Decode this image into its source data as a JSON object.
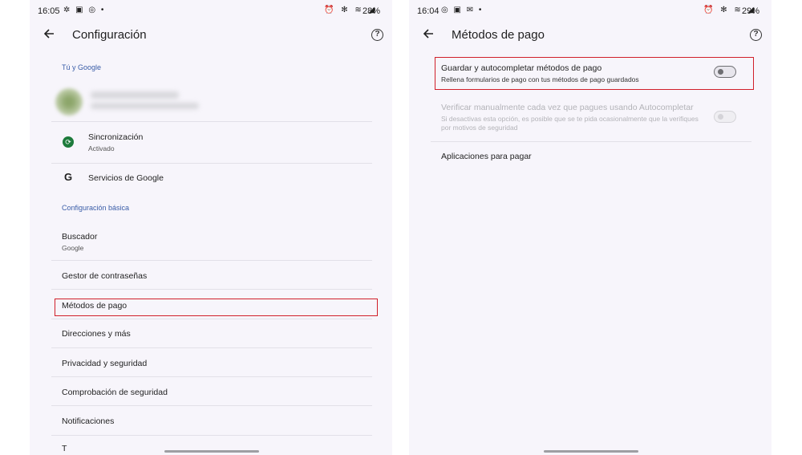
{
  "left": {
    "status": {
      "time": "16:05",
      "icons": "✲ ▣ ◎ •",
      "right_icons": "⏰ ✻ ≋ ◢",
      "battery": "28%"
    },
    "title": "Configuración",
    "help": "?",
    "sections": {
      "you_google": "Tú y Google",
      "basic": "Configuración básica"
    },
    "sync": {
      "title": "Sincronización",
      "sub": "Activado",
      "icon": "⟳"
    },
    "google_services": {
      "title": "Servicios de Google",
      "icon": "G"
    },
    "search_engine": {
      "title": "Buscador",
      "sub": "Google"
    },
    "items": {
      "passwords": "Gestor de contraseñas",
      "payment": "Métodos de pago",
      "addresses": "Direcciones y más",
      "privacy": "Privacidad y seguridad",
      "safety_check": "Comprobación de seguridad",
      "notifications": "Notificaciones",
      "partial": "T"
    }
  },
  "right": {
    "status": {
      "time": "16:04",
      "icons": "◎ ▣ ✉ •",
      "right_icons": "⏰ ✻ ≋ ◢",
      "battery": "29%"
    },
    "title": "Métodos de pago",
    "help": "?",
    "save_autofill": {
      "title": "Guardar y autocompletar métodos de pago",
      "sub": "Rellena formularios de pago con tus métodos de pago guardados"
    },
    "verify": {
      "title": "Verificar manualmente cada vez que pagues usando Autocompletar",
      "sub": "Si desactivas esta opción, es posible que se te pida ocasionalmente que la verifiques por motivos de seguridad"
    },
    "payment_apps": "Aplicaciones para pagar"
  },
  "colors": {
    "highlight": "#d01f2a",
    "section": "#3a5da8",
    "background": "#f7f5fb"
  }
}
